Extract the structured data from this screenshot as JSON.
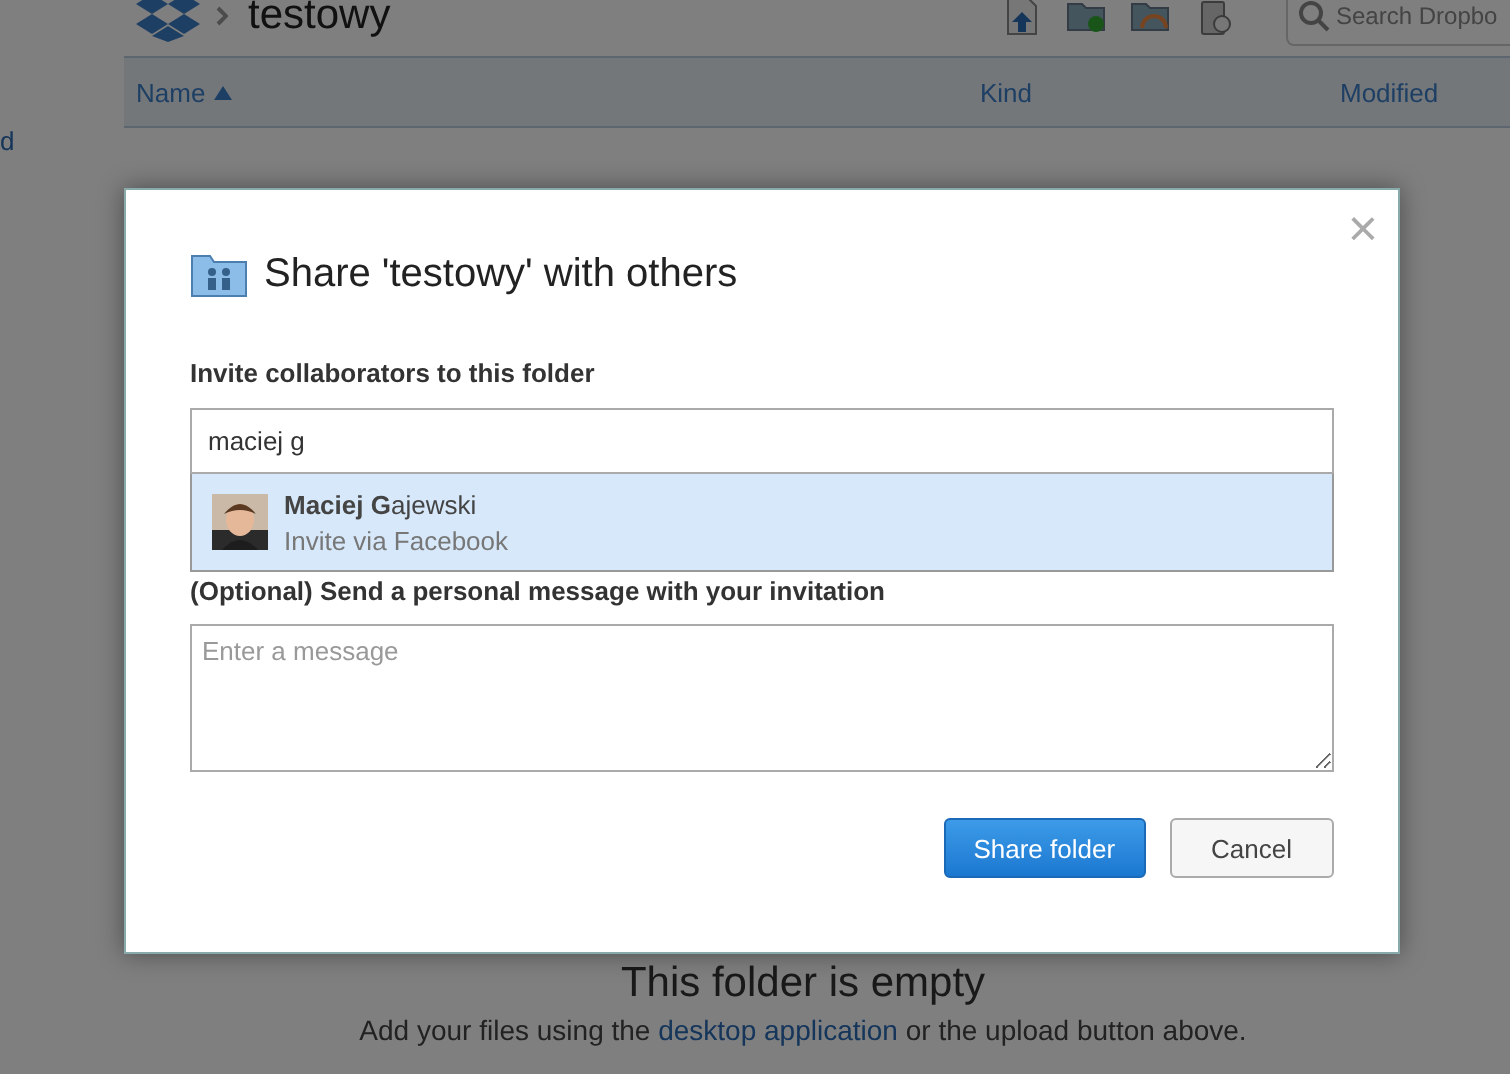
{
  "page": {
    "breadcrumb": "testowy",
    "search": {
      "placeholder": "Search Dropbo"
    },
    "columns": [
      {
        "label": "Name",
        "sorted": true
      },
      {
        "label": "Kind",
        "sorted": false
      },
      {
        "label": "Modified",
        "sorted": false
      }
    ],
    "sidebar_link": "d",
    "empty_title": "This folder is empty",
    "empty_text": {
      "before": "Add your files using the ",
      "link": "desktop application",
      "after": " or the upload button above."
    }
  },
  "dialog": {
    "title": "Share 'testowy' with others",
    "close": "×",
    "invite_label": "Invite collaborators to this folder",
    "invite_value": "maciej g",
    "suggestions": [
      {
        "name": "**Maciej G**ajewski",
        "detail": "Invite via Facebook",
        "selected": true
      }
    ],
    "message_label": "(Optional) Send a personal message with your invitation",
    "message": {
      "placeholder": "Enter a message"
    },
    "buttons": [
      {
        "label": "Share folder",
        "kind": "primary"
      },
      {
        "label": "Cancel",
        "kind": "secondary"
      }
    ]
  }
}
